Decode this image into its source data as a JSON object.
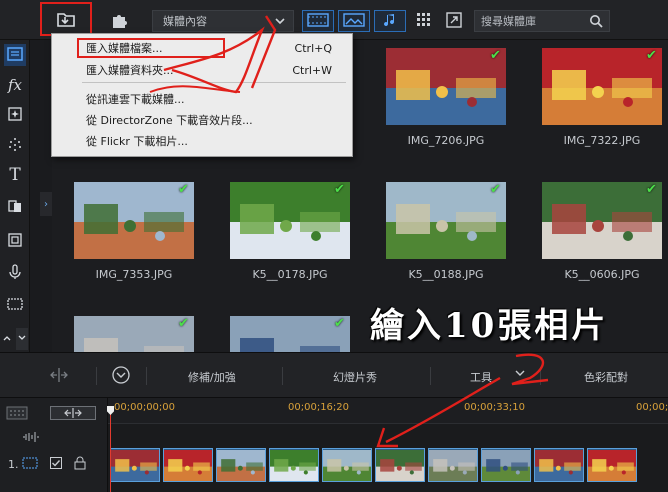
{
  "toolbar": {
    "import_icon": "import-media-icon",
    "plugin_icon": "puzzle-icon",
    "content_select": "媒體內容",
    "filters": [
      "video-filter-icon",
      "image-filter-icon",
      "audio-filter-icon"
    ],
    "search_placeholder": "搜尋媒體庫"
  },
  "rail": [
    "media-room-icon",
    "fx-icon",
    "particle-icon",
    "sparkle-icon",
    "title-icon",
    "transition-icon",
    "pip-icon",
    "mic-icon",
    "subtitle-icon"
  ],
  "menu": {
    "items": [
      {
        "label": "匯入媒體檔案...",
        "shortcut": "Ctrl+Q"
      },
      {
        "label": "匯入媒體資料夾...",
        "shortcut": "Ctrl+W"
      },
      {
        "label": "從訊連雲下載媒體..."
      },
      {
        "label": "從 DirectorZone 下載音效片段..."
      },
      {
        "label": "從 Flickr 下載相片..."
      }
    ]
  },
  "media": [
    {
      "name": "IMG_7206.JPG",
      "tone": [
        "#9c2d34",
        "#f1c04a",
        "#3d6a9e"
      ]
    },
    {
      "name": "IMG_7322.JPG",
      "tone": [
        "#b8242a",
        "#f3d24f",
        "#d57d37"
      ]
    },
    {
      "name": "IMG_7353.JPG",
      "tone": [
        "#9fb7cf",
        "#3f6f34",
        "#c27045"
      ]
    },
    {
      "name": "K5__0178.JPG",
      "tone": [
        "#3d7f2c",
        "#70a84a",
        "#dfe6ef"
      ]
    },
    {
      "name": "K5__0188.JPG",
      "tone": [
        "#9fb8c9",
        "#c9c4a8",
        "#4f8634"
      ]
    },
    {
      "name": "K5__0606.JPG",
      "tone": [
        "#3c6e38",
        "#a8443e",
        "#d8d3cb"
      ]
    },
    {
      "name": "",
      "tone": [
        "#9aa9b8",
        "#c6c2bb",
        "#6c7d56"
      ]
    },
    {
      "name": "",
      "tone": [
        "#8aa1b8",
        "#2f4f7f",
        "#5f8a3a"
      ]
    }
  ],
  "caption": "繪入10張相片",
  "annotations": [
    "1",
    "2"
  ],
  "timeline": {
    "tools": [
      "修補/加強",
      "幻燈片秀",
      "工具",
      "色彩配對"
    ],
    "timecodes": [
      "00;00;00;00",
      "00;00;16;20",
      "00;00;33;10",
      "00;00;50"
    ],
    "track_label": "1.",
    "clip_count": 10
  }
}
